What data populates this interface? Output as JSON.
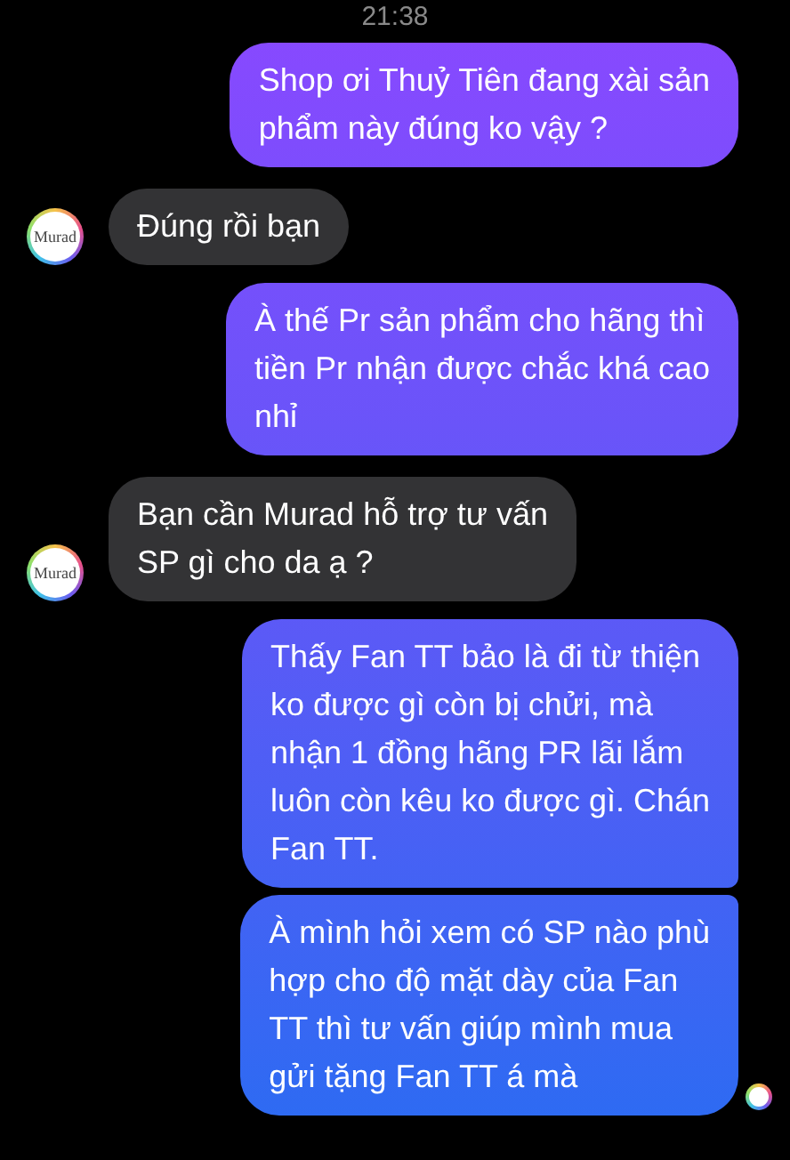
{
  "timestamp": "21:38",
  "messages": [
    {
      "kind": "outgoing",
      "lines": [
        "Shop ơi Thuỷ Tiên đang xài sản",
        "phẩm này đúng ko vậy ?"
      ]
    },
    {
      "kind": "incoming",
      "avatar_label": "Murad",
      "lines": [
        "Đúng rồi bạn"
      ]
    },
    {
      "kind": "outgoing",
      "lines": [
        "À thế Pr sản phẩm cho hãng thì",
        "tiền Pr nhận được chắc khá cao",
        "nhỉ"
      ]
    },
    {
      "kind": "incoming",
      "avatar_label": "Murad",
      "lines": [
        "Bạn cần Murad hỗ trợ tư vấn",
        "SP gì cho da ạ ?"
      ]
    },
    {
      "kind": "outgoing",
      "lines": [
        "Thấy Fan TT bảo là đi từ thiện",
        "ko được gì còn bị chửi, mà",
        "nhận 1 đồng hãng PR lãi lắm",
        "luôn còn kêu ko được gì. Chán",
        "Fan TT."
      ]
    },
    {
      "kind": "outgoing",
      "seen": true,
      "lines": [
        "À mình hỏi xem có SP nào phù",
        "hợp cho độ mặt dày của Fan",
        "TT thì tư vấn giúp mình mua",
        "gửi tặng Fan TT á mà"
      ]
    }
  ]
}
